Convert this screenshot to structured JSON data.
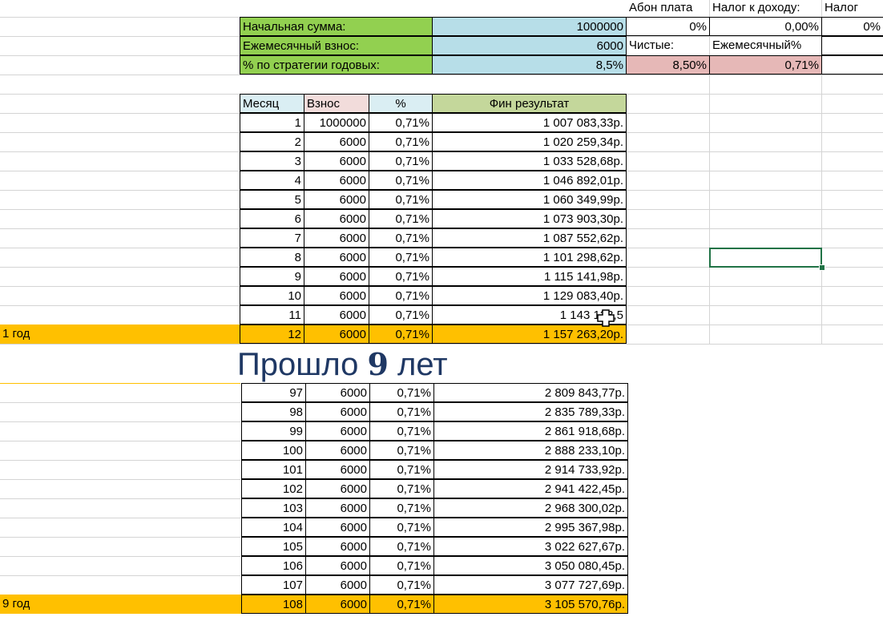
{
  "header_block": {
    "initial_sum_label": "Начальная сумма:",
    "initial_sum_value": "1000000",
    "monthly_label": "Ежемесячный взнос:",
    "monthly_value": "6000",
    "rate_label": "% по стратегии годовых:",
    "rate_value": "8,5%",
    "abon_label": "Абон плата",
    "abon_value": "0%",
    "net_label": "Чистые:",
    "net_value": "8,50%",
    "tax_income_label": "Налог к доходу:",
    "tax_income_value": "0,00%",
    "monthly_pct_label": "Ежемесячный%",
    "monthly_pct_value": "0,71%",
    "tax_label": "Налог",
    "tax_value": "0%"
  },
  "table": {
    "headers": [
      "Месяц",
      "Взнос",
      "%",
      "Фин результат"
    ],
    "rows_year1": [
      [
        "1",
        "1000000",
        "0,71%",
        "1 007 083,33р."
      ],
      [
        "2",
        "6000",
        "0,71%",
        "1 020 259,34р."
      ],
      [
        "3",
        "6000",
        "0,71%",
        "1 033 528,68р."
      ],
      [
        "4",
        "6000",
        "0,71%",
        "1 046 892,01р."
      ],
      [
        "5",
        "6000",
        "0,71%",
        "1 060 349,99р."
      ],
      [
        "6",
        "6000",
        "0,71%",
        "1 073 903,30р."
      ],
      [
        "7",
        "6000",
        "0,71%",
        "1 087 552,62р."
      ],
      [
        "8",
        "6000",
        "0,71%",
        "1 101 298,62р."
      ],
      [
        "9",
        "6000",
        "0,71%",
        "1 115 141,98р."
      ],
      [
        "10",
        "6000",
        "0,71%",
        "1 129 083,40р."
      ],
      [
        "11",
        "6000",
        "0,71%",
        "1 143 123,5"
      ]
    ],
    "year1_total": {
      "label": "1 год",
      "cells": [
        "12",
        "6000",
        "0,71%",
        "1 157 263,20р."
      ]
    },
    "banner_left": "Прошло ",
    "banner_num": "9",
    "banner_right": " лет",
    "rows_year9": [
      [
        "97",
        "6000",
        "0,71%",
        "2 809 843,77р."
      ],
      [
        "98",
        "6000",
        "0,71%",
        "2 835 789,33р."
      ],
      [
        "99",
        "6000",
        "0,71%",
        "2 861 918,68р."
      ],
      [
        "100",
        "6000",
        "0,71%",
        "2 888 233,10р."
      ],
      [
        "101",
        "6000",
        "0,71%",
        "2 914 733,92р."
      ],
      [
        "102",
        "6000",
        "0,71%",
        "2 941 422,45р."
      ],
      [
        "103",
        "6000",
        "0,71%",
        "2 968 300,02р."
      ],
      [
        "104",
        "6000",
        "0,71%",
        "2 995 367,98р."
      ],
      [
        "105",
        "6000",
        "0,71%",
        "3 022 627,67р."
      ],
      [
        "106",
        "6000",
        "0,71%",
        "3 050 080,45р."
      ],
      [
        "107",
        "6000",
        "0,71%",
        "3 077 727,69р."
      ]
    ],
    "year9_total": {
      "label": "9 год",
      "cells": [
        "108",
        "6000",
        "0,71%",
        "3 105 570,76р."
      ]
    }
  },
  "colors": {
    "label_green": "#92d050",
    "value_blue": "#b7dee8",
    "result_pink": "#e6b8b7",
    "total_orange": "#ffc000",
    "banner_text": "#1f3864",
    "selection": "#217346"
  },
  "icons": {
    "cursor": "excel-cross-cursor-icon"
  }
}
